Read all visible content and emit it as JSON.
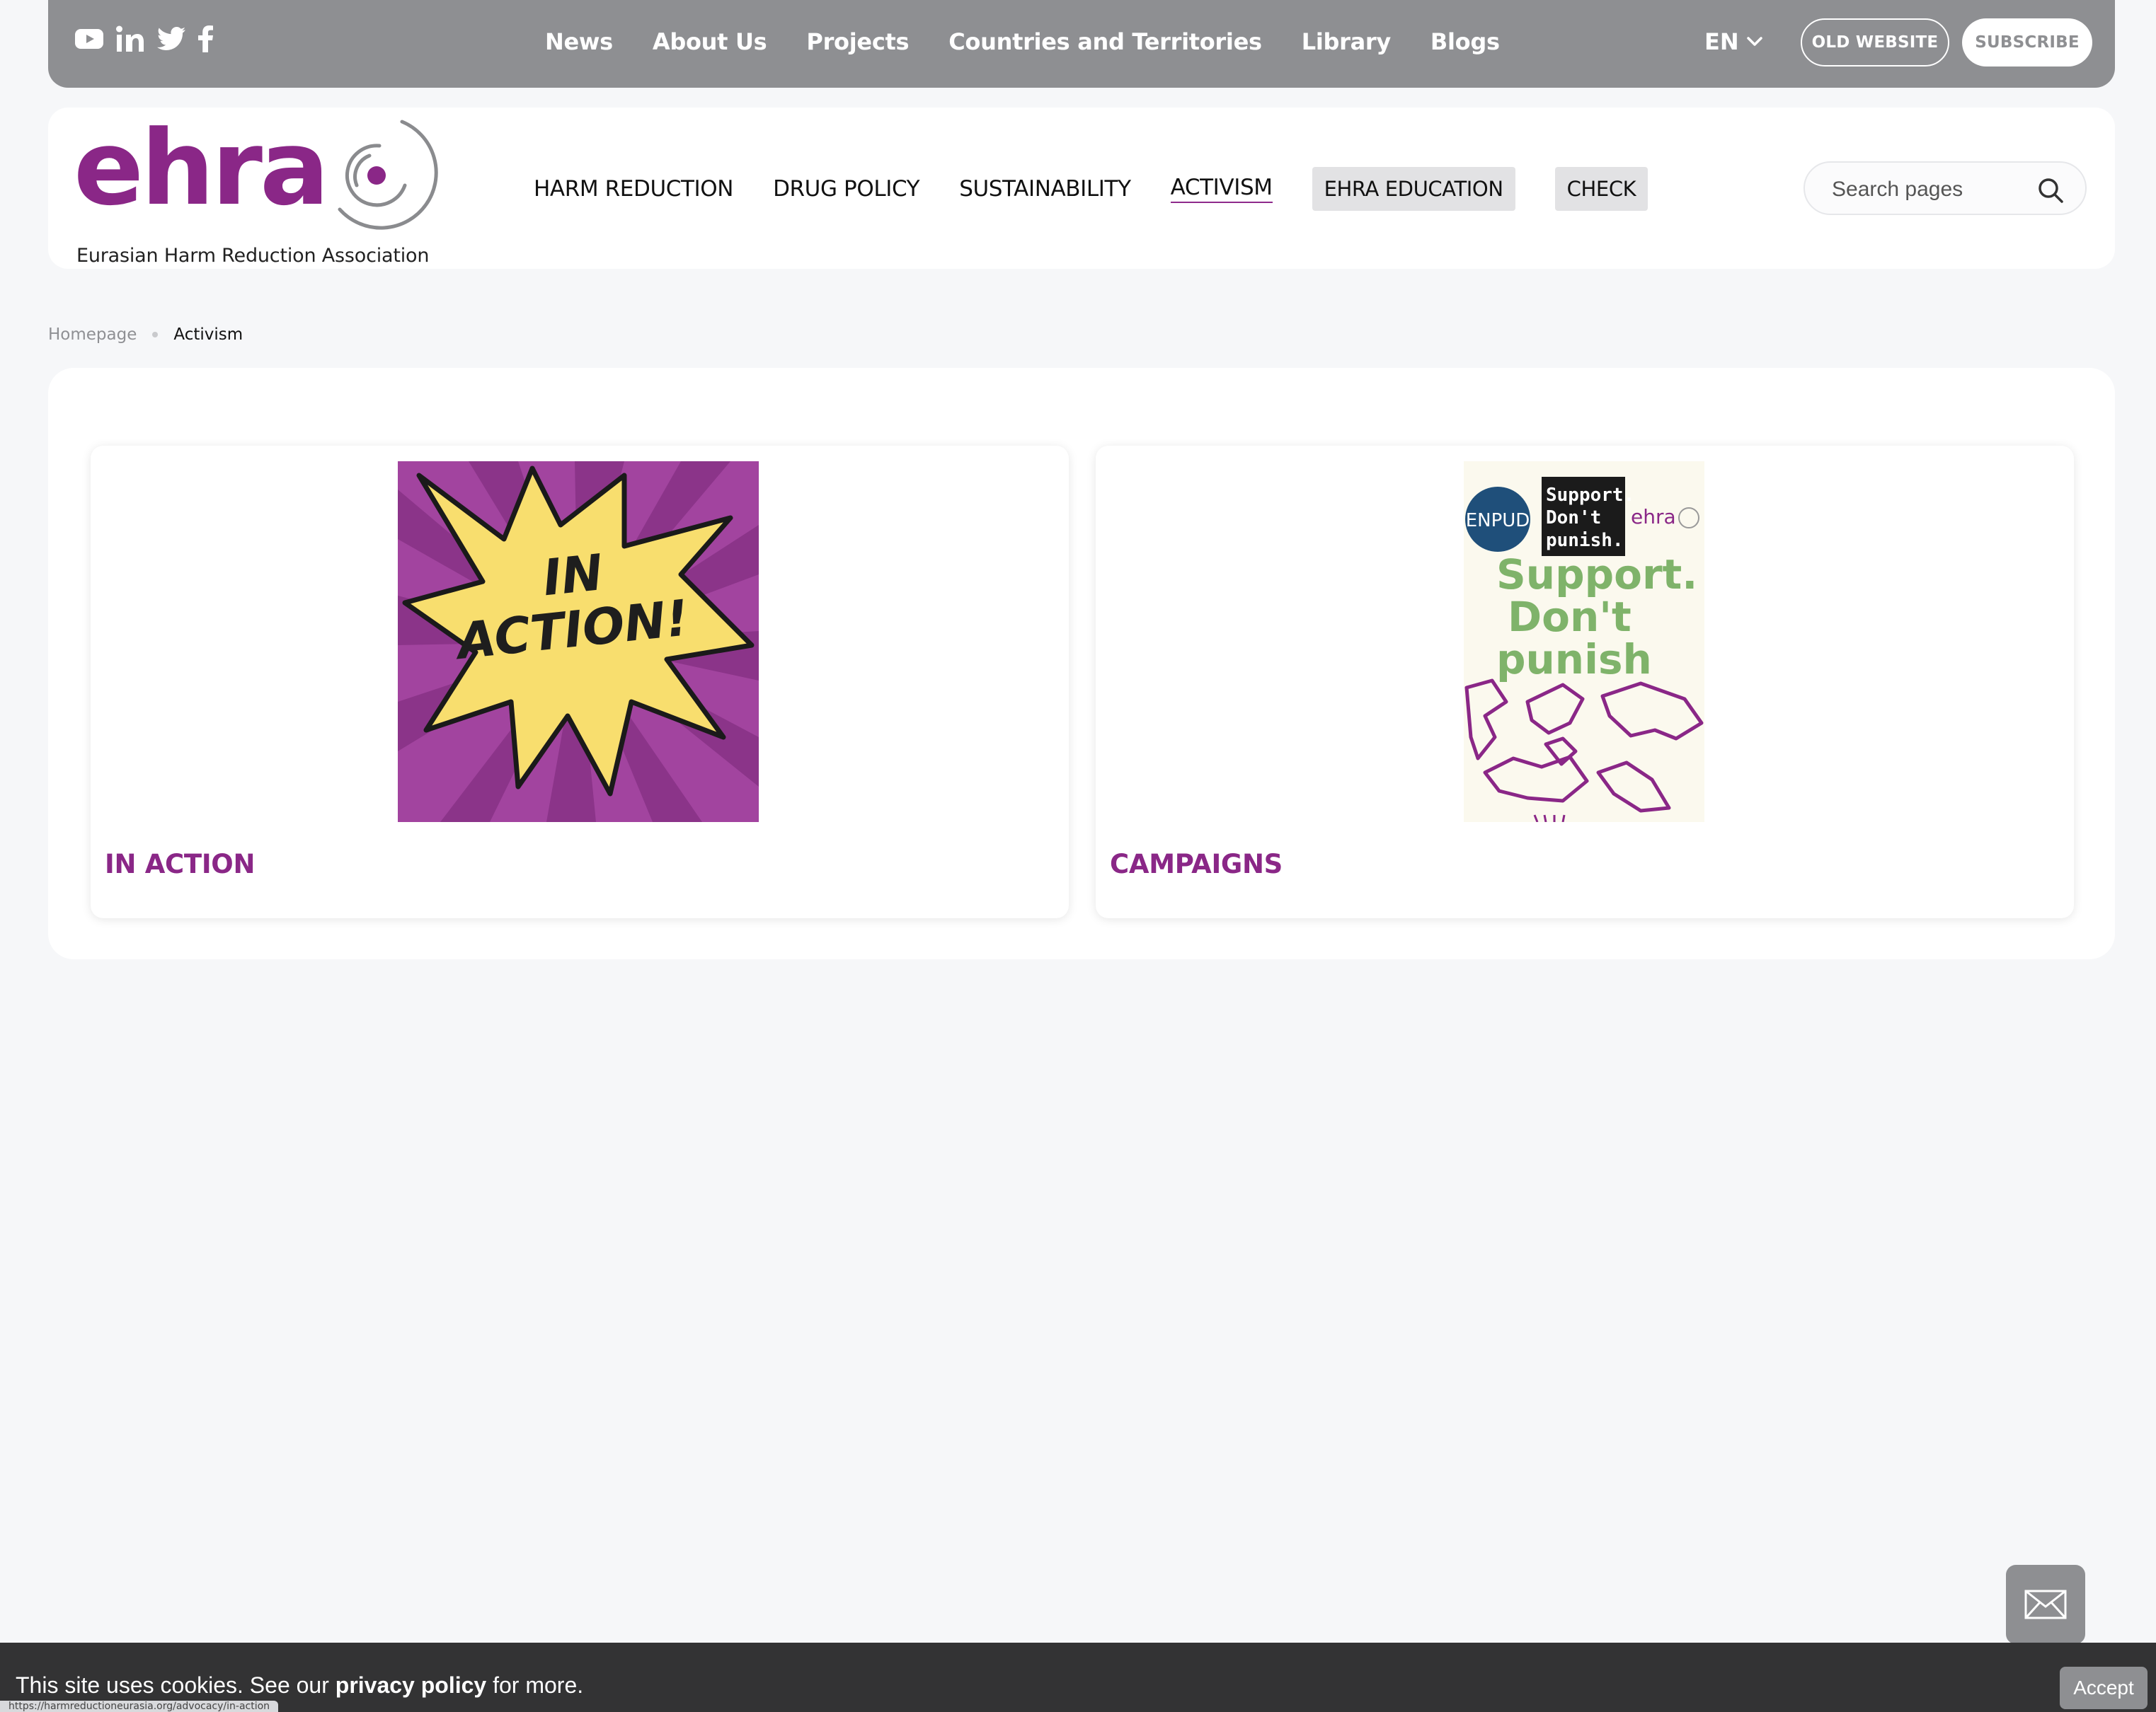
{
  "topbar": {
    "social": [
      {
        "icon": "youtube-icon",
        "label": "YouTube"
      },
      {
        "icon": "linkedin-icon",
        "label": "LinkedIn"
      },
      {
        "icon": "twitter-icon",
        "label": "Twitter"
      },
      {
        "icon": "facebook-icon",
        "label": "Facebook"
      }
    ],
    "nav": [
      "News",
      "About Us",
      "Projects",
      "Countries and Territories",
      "Library",
      "Blogs"
    ],
    "language": "EN",
    "old_website": "OLD WEBSITE",
    "subscribe": "SUBSCRIBE"
  },
  "header": {
    "logo_text": "ehra",
    "logo_subtitle": "Eurasian Harm Reduction Association",
    "nav": [
      "HARM REDUCTION",
      "DRUG POLICY",
      "SUSTAINABILITY",
      "ACTIVISM",
      "EHRA EDUCATION",
      "CHECK"
    ],
    "active": "ACTIVISM",
    "search_placeholder": "Search pages"
  },
  "breadcrumb": {
    "home": "Homepage",
    "current": "Activism"
  },
  "cards": [
    {
      "title": "IN ACTION",
      "image_text": [
        "IN",
        "ACTION!"
      ]
    },
    {
      "title": "CAMPAIGNS",
      "image_text": {
        "badge": "ENPUD",
        "box": [
          "Support.",
          "Don't",
          "punish."
        ],
        "brand": "ehra",
        "headline": [
          "Support.",
          "Don't",
          "punish"
        ]
      }
    }
  ],
  "cookie": {
    "text_before": "This site uses cookies. See our ",
    "link": "privacy policy",
    "text_after": " for more.",
    "accept": "Accept"
  },
  "status_url": "https://harmreductioneurasia.org/advocacy/in-action",
  "colors": {
    "brand_purple": "#8a2787",
    "topbar_gray": "#8e8f92",
    "page_bg": "#f6f7f9",
    "cookie_bg": "#333334"
  }
}
